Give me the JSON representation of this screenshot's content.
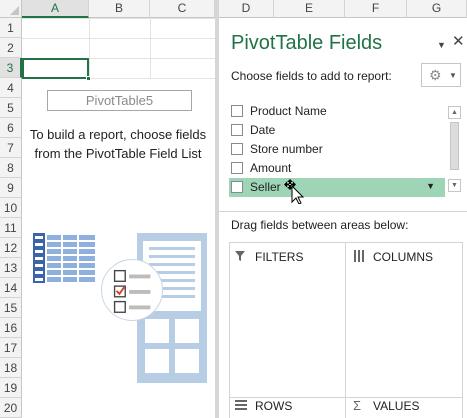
{
  "columns": [
    "A",
    "B",
    "C",
    "D",
    "E",
    "F",
    "G"
  ],
  "selected_column": "A",
  "rows": [
    "1",
    "2",
    "3",
    "4",
    "5",
    "6",
    "7",
    "8",
    "9",
    "10",
    "11",
    "12",
    "13",
    "14",
    "15",
    "16",
    "17",
    "18",
    "19",
    "20"
  ],
  "selected_row": "3",
  "pivot": {
    "name": "PivotTable5",
    "message": "To build a report, choose fields from the PivotTable Field List"
  },
  "pane": {
    "title": "PivotTable Fields",
    "choose_label": "Choose fields to add to report:",
    "fields": [
      {
        "label": "Product Name",
        "checked": false
      },
      {
        "label": "Date",
        "checked": false
      },
      {
        "label": "Store number",
        "checked": false
      },
      {
        "label": "Amount",
        "checked": false
      },
      {
        "label": "Seller",
        "checked": false,
        "highlighted": true
      }
    ],
    "drag_label": "Drag fields between areas below:",
    "areas": {
      "filters": "FILTERS",
      "columns": "COLUMNS",
      "rows": "ROWS",
      "values": "VALUES"
    }
  },
  "colors": {
    "accent": "#217346",
    "highlight": "#9fd5b7",
    "illustration_blue": "#b7cde4",
    "table_blue": "#4a6fb0"
  }
}
